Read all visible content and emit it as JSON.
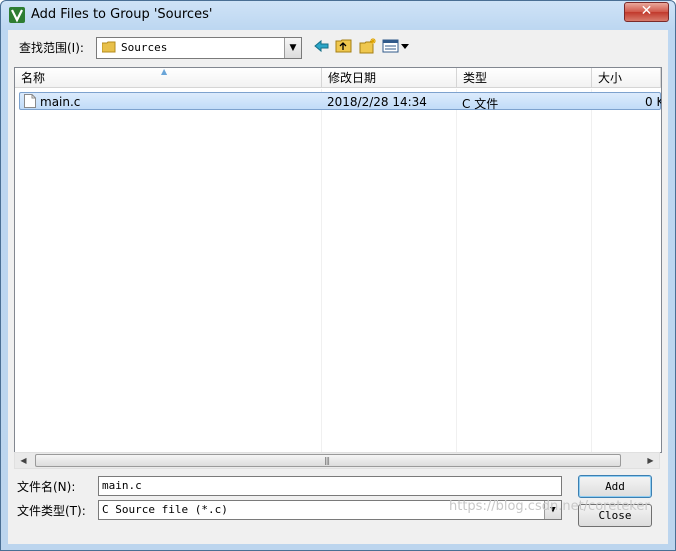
{
  "window": {
    "title": "Add Files to Group 'Sources'",
    "close_glyph": "✕"
  },
  "toolbar": {
    "look_in_label": "查找范围(I):",
    "look_in_value": "Sources",
    "icons": [
      "back-arrow-icon",
      "up-folder-icon",
      "new-folder-icon",
      "view-menu-icon"
    ]
  },
  "list": {
    "columns": [
      "名称",
      "修改日期",
      "类型",
      "大小"
    ],
    "rows": [
      {
        "name": "main.c",
        "modified": "2018/2/28 14:34",
        "type": "C 文件",
        "size": "0 K"
      }
    ]
  },
  "filename": {
    "label": "文件名(N):",
    "value": "main.c"
  },
  "filetype": {
    "label": "文件类型(T):",
    "value": "C Source file (*.c)"
  },
  "buttons": {
    "add": "Add",
    "close": "Close"
  },
  "watermark": "https://blog.csdn.net/coreteker",
  "colors": {
    "titlebar": "#bdd7f1",
    "selection": "#cde3fb",
    "close": "#c1392c"
  }
}
